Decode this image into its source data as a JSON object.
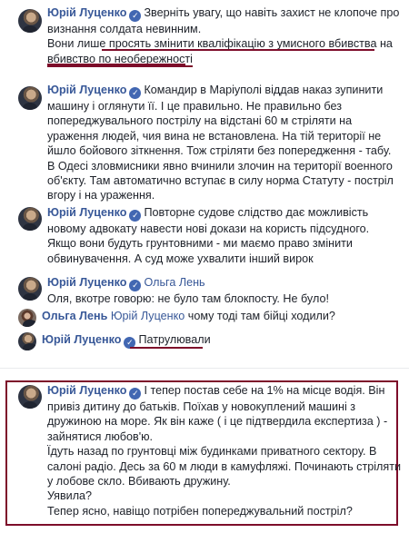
{
  "comments": [
    {
      "author": "Юрій Луценко",
      "lines": [
        "Зверніть увагу, що навіть захист не клопоче про",
        "визнання солдата невинним.",
        "Вони лише просять змінити кваліфікацію з умисного вбивства на",
        "вбивство по необережності"
      ]
    },
    {
      "author": "Юрій Луценко",
      "lines": [
        "Командир в Маріуполі віддав наказ зупинити",
        "машину і оглянути її. І це правильно. Не правильно без",
        "попереджувального пострілу на відстані 60 м стріляти на",
        "ураження людей, чия вина не встановлена. На тій території не",
        "йшло бойового зіткнення. Тож стріляти без попередження - табу.",
        "В Одесі зловмисники явно вчинили злочин на території военного",
        "об'єкту. Там автоматично вступає в силу норма Статуту - постріл",
        "вгору і на ураження."
      ]
    },
    {
      "author": "Юрій Луценко",
      "lines": [
        "Повторне судове слідство дає можливість",
        "новому адвокату навести нові докази на користь підсудного.",
        "Якщо вони будуть грунтовними - ми маємо право змінити",
        "обвинувачення. А суд може ухвалити інший вирок"
      ]
    },
    {
      "author": "Юрій Луценко",
      "mention": "Ольга Лень",
      "lines": [
        "Оля, вкотре говорю: не було там блокпосту. Не було!"
      ]
    },
    {
      "author": "Ольга Лень",
      "mention": "Юрій Луценко",
      "text": "чому тоді там бійці ходили?"
    },
    {
      "author": "Юрій Луценко",
      "text": "Патрулювали"
    },
    {
      "author": "Юрій Луценко",
      "lines": [
        "І тепер постав себе на 1% на місце водія. Він",
        "привіз дитину до батьків. Поїхав у новокуплений машині з",
        "дружиною на море. Як він каже ( і це підтвердила експертиза ) -",
        "зайнятися любов'ю.",
        "Їдуть назад по грунтовці між будинками приватного сектору. В",
        "салоні радіо. Десь за 60 м люди в камуфляжі. Починають стріляти",
        "у лобове скло. Вбивають дружину.",
        "Уявила?",
        "Тепер ясно, навіщо потрібен попереджувальний постріл?"
      ]
    }
  ],
  "colors": {
    "author": "#385898",
    "verified_badge": "#4267b2",
    "highlight_border": "#7d0d2a",
    "text": "#1d2129"
  },
  "icons": {
    "verified": "verified-check-icon"
  }
}
